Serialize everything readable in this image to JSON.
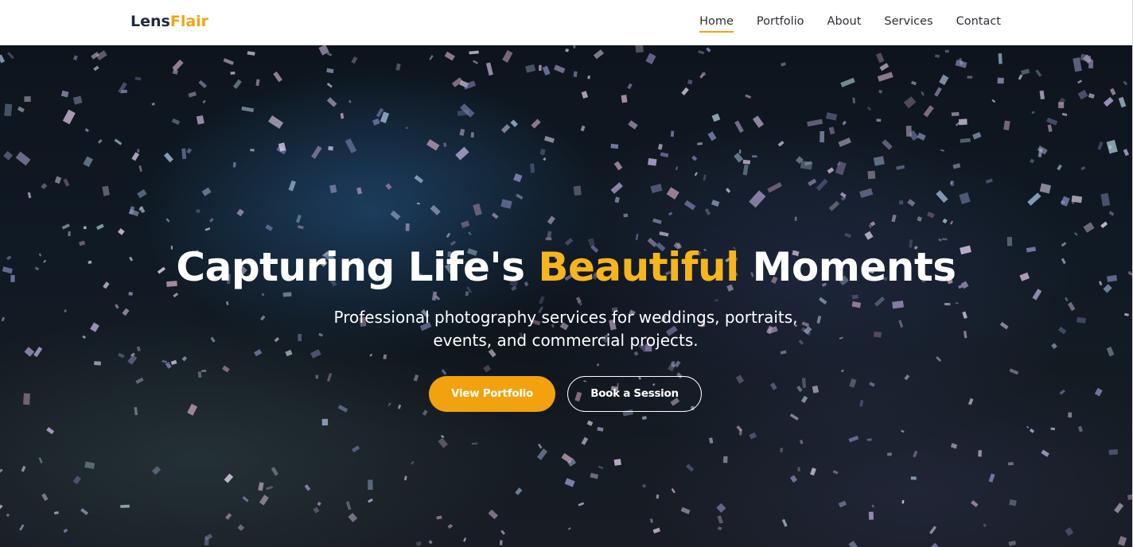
{
  "brand": {
    "name_part1": "Lens",
    "name_part2": "Flair",
    "accent_color": "#f2a413"
  },
  "nav": {
    "items": [
      {
        "label": "Home",
        "active": true
      },
      {
        "label": "Portfolio",
        "active": false
      },
      {
        "label": "About",
        "active": false
      },
      {
        "label": "Services",
        "active": false
      },
      {
        "label": "Contact",
        "active": false
      }
    ]
  },
  "hero": {
    "background": "confetti-celebration-photo",
    "title_part1": "Capturing Life's ",
    "title_highlight": "Beautiful",
    "title_part2": " Moments",
    "highlight_color": "#f5b51c",
    "subtitle": "Professional photography services for weddings, portraits, events, and commercial projects.",
    "primary_button": "View Portfolio",
    "primary_button_color": "#f2a20f",
    "secondary_button": "Book a Session"
  }
}
